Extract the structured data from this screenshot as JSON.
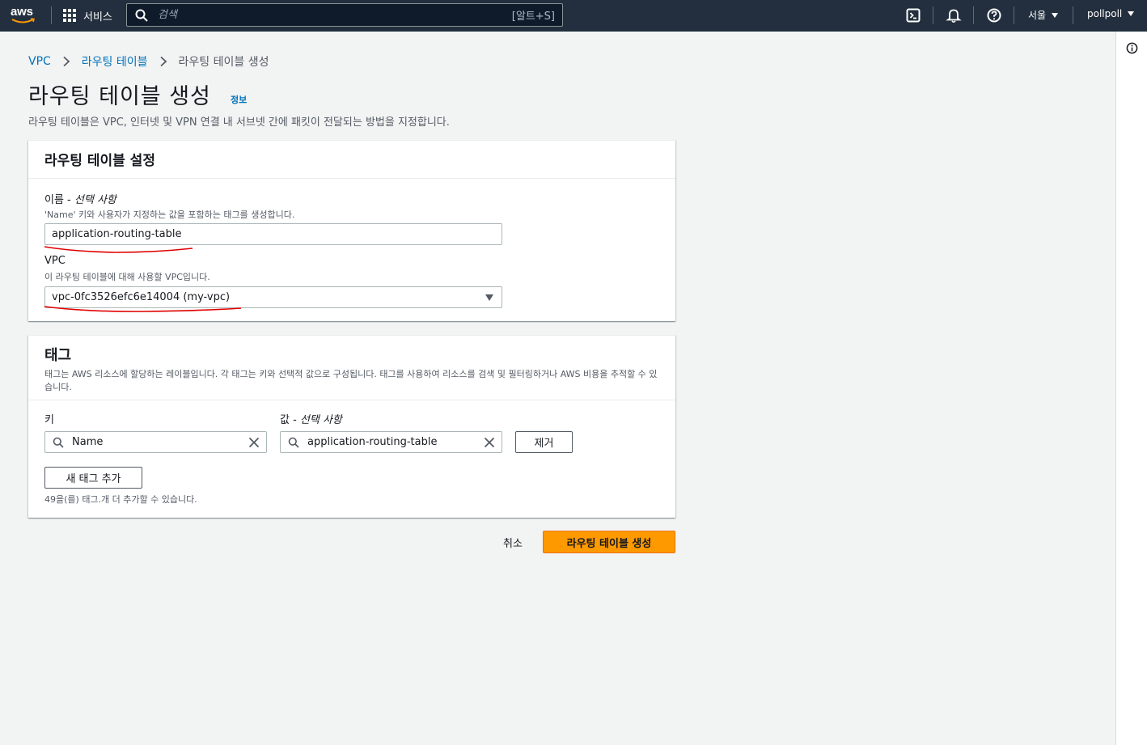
{
  "nav": {
    "logo_text": "aws",
    "services_label": "서비스",
    "search_placeholder": "검색",
    "search_shortcut": "[알트+S]",
    "region_label": "서울",
    "account_label": "pollpoll"
  },
  "breadcrumb": {
    "items": [
      "VPC",
      "라우팅 테이블"
    ],
    "current": "라우팅 테이블 생성"
  },
  "page": {
    "title": "라우팅 테이블 생성",
    "info_link": "정보",
    "description": "라우팅 테이블은 VPC, 인터넷 및 VPN 연결 내 서브넷 간에 패킷이 전달되는 방법을 지정합니다."
  },
  "settings": {
    "title": "라우팅 테이블 설정",
    "name_label": "이름 - ",
    "name_optional": "선택 사항",
    "name_desc": "'Name' 키와 사용자가 지정하는 값을 포함하는 태그를 생성합니다.",
    "name_value": "application-routing-table",
    "vpc_label": "VPC",
    "vpc_desc": "이 라우팅 테이블에 대해 사용할 VPC입니다.",
    "vpc_value": "vpc-0fc3526efc6e14004 (my-vpc)"
  },
  "tags": {
    "title": "태그",
    "description": "태그는 AWS 리소스에 할당하는 레이블입니다. 각 태그는 키와 선택적 값으로 구성됩니다. 태그를 사용하여 리소스를 검색 및 필터링하거나 AWS 비용을 추적할 수 있습니다.",
    "key_label": "키",
    "value_label": "값 - ",
    "value_optional": "선택 사항",
    "rows": [
      {
        "key": "Name",
        "value": "application-routing-table",
        "remove_label": "제거"
      }
    ],
    "add_button": "새 태그 추가",
    "limit_note": "49을(를) 태그.개 더 추가할 수 있습니다."
  },
  "actions": {
    "cancel": "취소",
    "submit": "라우팅 테이블 생성"
  },
  "colors": {
    "nav_bg": "#232f3e",
    "link": "#0073bb",
    "primary": "#ff9900",
    "annotation": "#e00000"
  }
}
